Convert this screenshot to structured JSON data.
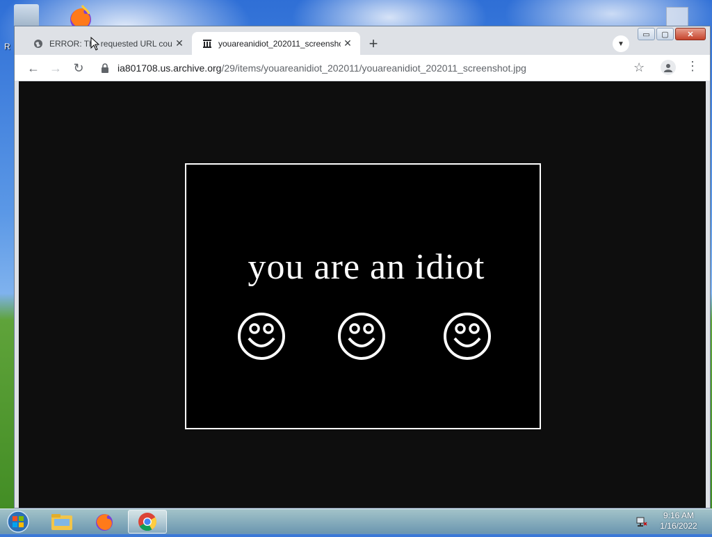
{
  "desktop": {
    "partial_label": "R"
  },
  "browser": {
    "tabs": [
      {
        "title": "ERROR: The requested URL could",
        "favicon": "globe-icon",
        "active": false
      },
      {
        "title": "youareanidiot_202011_screensho",
        "favicon": "archive-icon",
        "active": true
      }
    ],
    "new_tab": "+",
    "url_host": "ia801708.us.archive.org",
    "url_path": "/29/items/youareanidiot_202011/youareanidiot_202011_screenshot.jpg",
    "window_controls": {
      "minimize": "▭",
      "maximize": "▢",
      "close": "✕"
    }
  },
  "page": {
    "image_text": "you are an idiot",
    "smileys": [
      "smiley-face-icon",
      "smiley-face-icon",
      "smiley-face-icon"
    ]
  },
  "taskbar": {
    "items": [
      "start-orb",
      "explorer-icon",
      "firefox-icon",
      "chrome-icon"
    ],
    "active_item": "chrome-icon",
    "time": "9:16 AM",
    "date": "1/16/2022"
  },
  "colors": {
    "tab_strip": "#dee1e6",
    "page_bg": "#0e0e0e",
    "image_bg": "#000000",
    "text": "#ffffff"
  }
}
